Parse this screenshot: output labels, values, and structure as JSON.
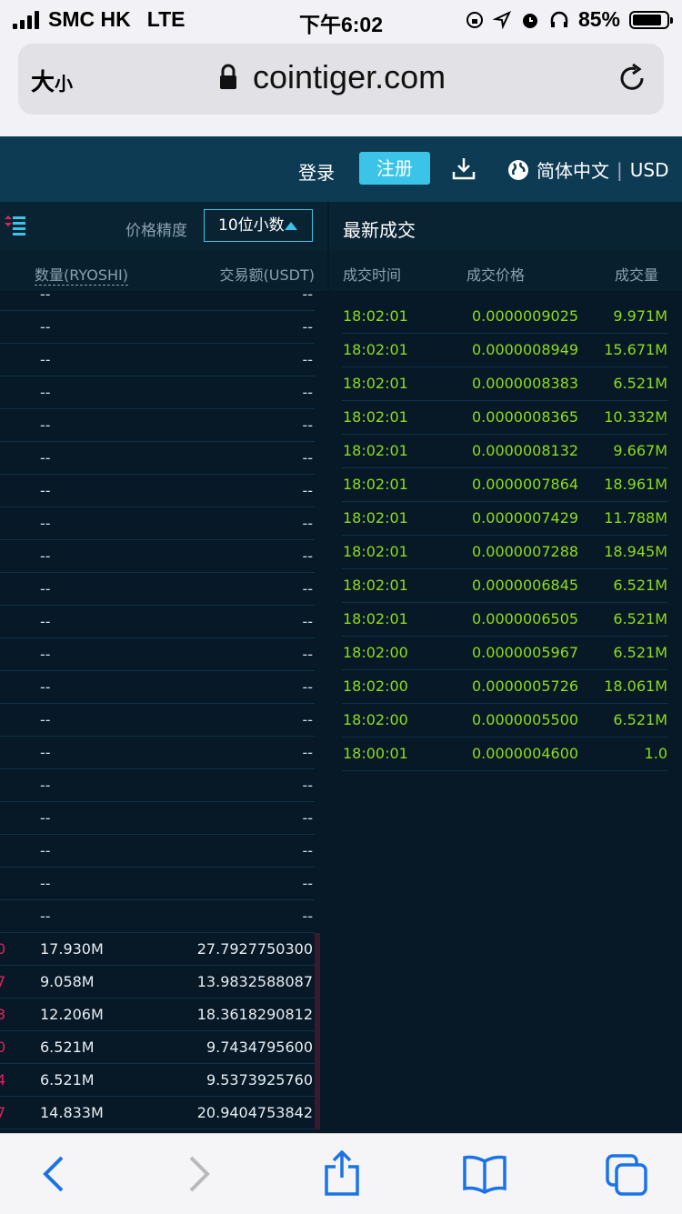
{
  "status_bar": {
    "carrier": "SMC HK",
    "network": "LTE",
    "time": "下午6:02",
    "battery": "85%"
  },
  "browser": {
    "text_size_label": "大",
    "text_size_small": "小",
    "domain": "cointiger.com"
  },
  "nav": {
    "login": "登录",
    "register": "注册",
    "language": "简体中文",
    "currency": "USD"
  },
  "orderbook": {
    "precision_label": "价格精度",
    "precision_value": "10位小数",
    "col_amount": "数量(RYOSHI)",
    "col_total": "交易额(USDT)",
    "asks": [
      {
        "a": "--",
        "b": "--"
      },
      {
        "a": "--",
        "b": "--"
      },
      {
        "a": "--",
        "b": "--"
      },
      {
        "a": "--",
        "b": "--"
      },
      {
        "a": "--",
        "b": "--"
      },
      {
        "a": "--",
        "b": "--"
      },
      {
        "a": "--",
        "b": "--"
      },
      {
        "a": "--",
        "b": "--"
      },
      {
        "a": "--",
        "b": "--"
      },
      {
        "a": "--",
        "b": "--"
      },
      {
        "a": "--",
        "b": "--"
      },
      {
        "a": "--",
        "b": "--"
      },
      {
        "a": "--",
        "b": "--"
      },
      {
        "a": "--",
        "b": "--"
      },
      {
        "a": "--",
        "b": "--"
      },
      {
        "a": "--",
        "b": "--"
      },
      {
        "a": "--",
        "b": "--"
      },
      {
        "a": "--",
        "b": "--"
      },
      {
        "a": "--",
        "b": "--"
      },
      {
        "a": "--",
        "b": "--"
      }
    ],
    "bids": [
      {
        "p": "0",
        "a": "17.930M",
        "b": "27.7927750300"
      },
      {
        "p": "7",
        "a": "9.058M",
        "b": "13.9832588087"
      },
      {
        "p": "3",
        "a": "12.206M",
        "b": "18.3618290812"
      },
      {
        "p": "0",
        "a": "6.521M",
        "b": "9.7434795600"
      },
      {
        "p": "4",
        "a": "6.521M",
        "b": "9.5373925760"
      },
      {
        "p": "7",
        "a": "14.833M",
        "b": "20.9404753842"
      }
    ]
  },
  "trades": {
    "title": "最新成交",
    "col_time": "成交时间",
    "col_price": "成交价格",
    "col_volume": "成交量",
    "rows": [
      {
        "t": "18:02:01",
        "p": "0.0000009025",
        "v": "9.971M"
      },
      {
        "t": "18:02:01",
        "p": "0.0000008949",
        "v": "15.671M"
      },
      {
        "t": "18:02:01",
        "p": "0.0000008383",
        "v": "6.521M"
      },
      {
        "t": "18:02:01",
        "p": "0.0000008365",
        "v": "10.332M"
      },
      {
        "t": "18:02:01",
        "p": "0.0000008132",
        "v": "9.667M"
      },
      {
        "t": "18:02:01",
        "p": "0.0000007864",
        "v": "18.961M"
      },
      {
        "t": "18:02:01",
        "p": "0.0000007429",
        "v": "11.788M"
      },
      {
        "t": "18:02:01",
        "p": "0.0000007288",
        "v": "18.945M"
      },
      {
        "t": "18:02:01",
        "p": "0.0000006845",
        "v": "6.521M"
      },
      {
        "t": "18:02:01",
        "p": "0.0000006505",
        "v": "6.521M"
      },
      {
        "t": "18:02:00",
        "p": "0.0000005967",
        "v": "6.521M"
      },
      {
        "t": "18:02:00",
        "p": "0.0000005726",
        "v": "18.061M"
      },
      {
        "t": "18:02:00",
        "p": "0.0000005500",
        "v": "6.521M"
      },
      {
        "t": "18:00:01",
        "p": "0.0000004600",
        "v": "1.0"
      }
    ]
  },
  "colors": {
    "accent": "#3cc4e8",
    "nav_bg": "#0d3b53",
    "page_bg": "#071826",
    "trade_green": "#8fdc1a",
    "bid_red": "#e0245e"
  },
  "icons": [
    "signal-icon",
    "lock-icon",
    "reload-icon",
    "download-icon",
    "globe-icon",
    "orderbook-menu-icon",
    "back-icon",
    "forward-icon",
    "share-icon",
    "bookmarks-icon",
    "tabs-icon"
  ]
}
